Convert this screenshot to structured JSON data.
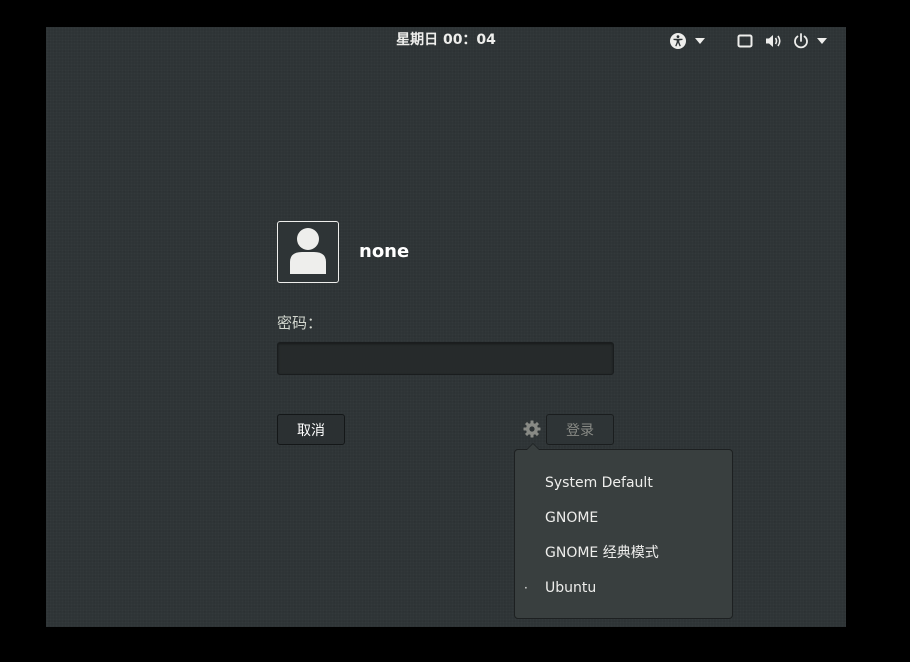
{
  "topbar": {
    "clock": "星期日 00：04",
    "icons": {
      "accessibility": "accessibility-icon",
      "accessibility_menu": "chevron-down-icon",
      "display": "display-icon",
      "volume": "volume-icon",
      "power": "power-icon",
      "system_menu": "chevron-down-icon"
    }
  },
  "login": {
    "avatar_icon": "user-avatar-icon",
    "username": "none",
    "password_label": "密码：",
    "password_value": "",
    "cancel_label": "取消",
    "login_label": "登录",
    "session_icon": "gear-icon"
  },
  "session_menu": {
    "items": [
      {
        "label": "System Default",
        "selected": false
      },
      {
        "label": "GNOME",
        "selected": false
      },
      {
        "label": "GNOME 经典模式",
        "selected": false
      },
      {
        "label": "Ubuntu",
        "selected": true
      }
    ],
    "selected_marker": "·"
  },
  "colors": {
    "background": "#2e3436",
    "menu_background": "#393f3f",
    "text": "#eeeeec",
    "disabled_text": "#888a85"
  }
}
